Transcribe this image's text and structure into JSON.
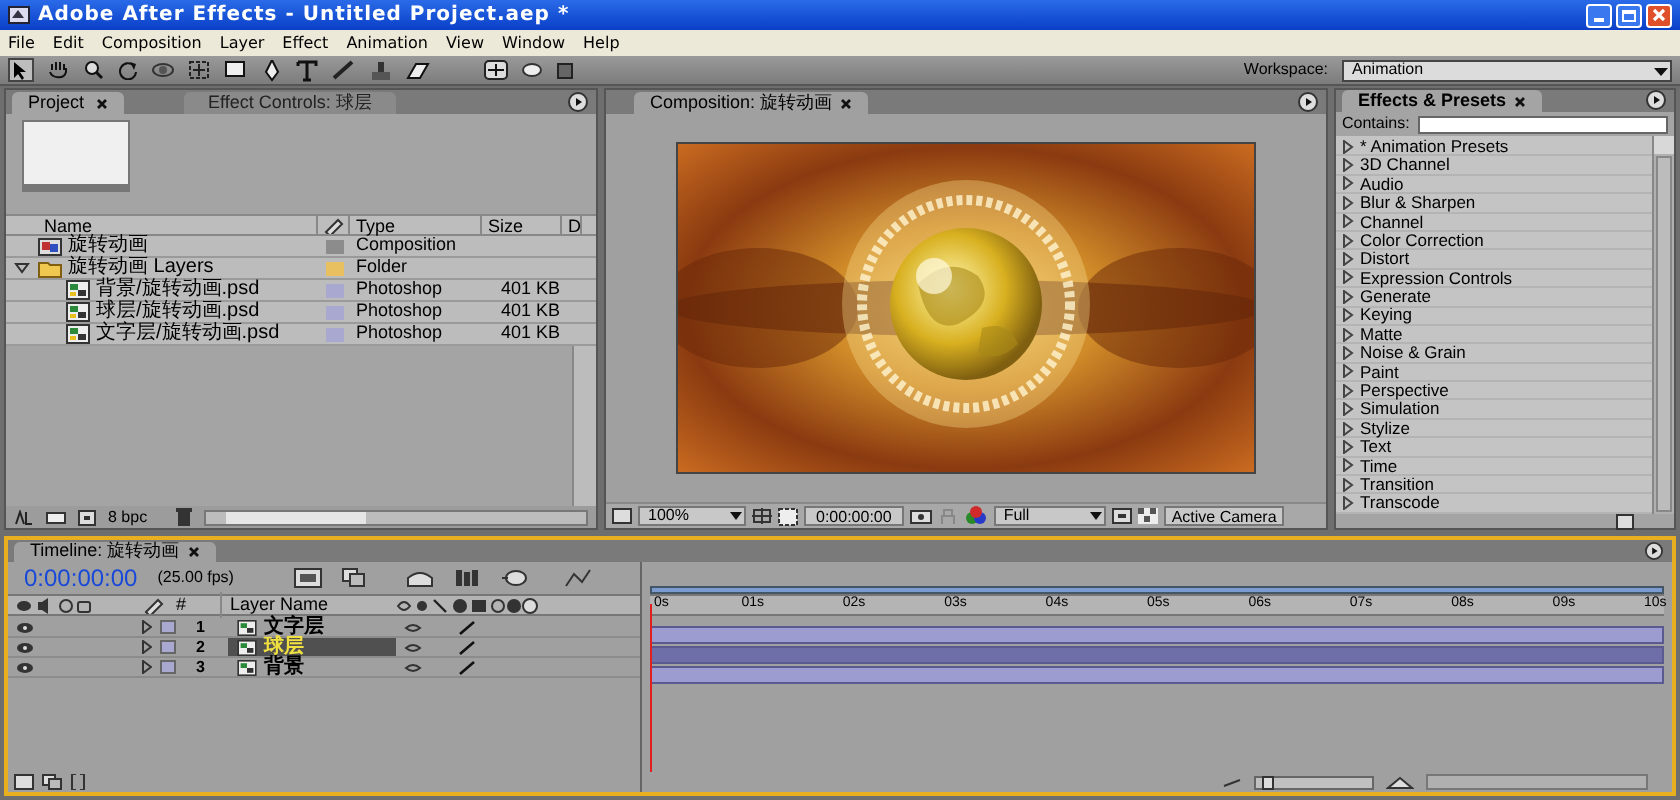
{
  "window": {
    "title": "Adobe After Effects - Untitled Project.aep *"
  },
  "menu": [
    {
      "label": "File"
    },
    {
      "label": "Edit"
    },
    {
      "label": "Composition"
    },
    {
      "label": "Layer"
    },
    {
      "label": "Effect"
    },
    {
      "label": "Animation"
    },
    {
      "label": "View"
    },
    {
      "label": "Window"
    },
    {
      "label": "Help"
    }
  ],
  "workspace": {
    "label": "Workspace:",
    "value": "Animation"
  },
  "project_panel": {
    "tabs": [
      {
        "label": "Project",
        "selected": true
      },
      {
        "label": "Effect Controls: 球层",
        "selected": false
      }
    ],
    "columns": [
      "Name",
      "Type",
      "Size",
      "D"
    ],
    "items": [
      {
        "name": "旋转动画",
        "kind": "comp",
        "color": "#8c8c8c",
        "type": "Composition"
      },
      {
        "name": "旋转动画 Layers",
        "kind": "folder",
        "color": "#e8c060",
        "type": "Folder",
        "expanded": true,
        "children": [
          {
            "name": "背景/旋转动画.psd",
            "kind": "footage",
            "color": "#a8a8d0",
            "type": "Photoshop",
            "size": "401 KB"
          },
          {
            "name": "球层/旋转动画.psd",
            "kind": "footage",
            "color": "#a8a8d0",
            "type": "Photoshop",
            "size": "401 KB"
          },
          {
            "name": "文字层/旋转动画.psd",
            "kind": "footage",
            "color": "#a8a8d0",
            "type": "Photoshop",
            "size": "401 KB"
          }
        ]
      }
    ],
    "bit_depth": "8 bpc"
  },
  "composition_panel": {
    "tab": "Composition: 旋转动画",
    "zoom": "100%",
    "timecode": "0:00:00:00",
    "resolution": "Full",
    "camera": "Active Camera"
  },
  "effects_panel": {
    "tab": "Effects & Presets",
    "contains_label": "Contains:",
    "items": [
      "* Animation Presets",
      "3D Channel",
      "Audio",
      "Blur & Sharpen",
      "Channel",
      "Color Correction",
      "Distort",
      "Expression Controls",
      "Generate",
      "Keying",
      "Matte",
      "Noise & Grain",
      "Paint",
      "Perspective",
      "Simulation",
      "Stylize",
      "Text",
      "Time",
      "Transition",
      "Transcode"
    ]
  },
  "timeline": {
    "tab": "Timeline: 旋转动画",
    "timecode": "0:00:00:00",
    "fps": "(25.00 fps)",
    "columns": [
      "#",
      "Layer Name"
    ],
    "layers": [
      {
        "number": "1",
        "name": "文字层",
        "selected": false
      },
      {
        "number": "2",
        "name": "球层",
        "selected": true
      },
      {
        "number": "3",
        "name": "背景",
        "selected": false
      }
    ],
    "zoom_slider": {
      "level": 0.05
    },
    "ticks": [
      "0s",
      "01s",
      "02s",
      "03s",
      "04s",
      "05s",
      "06s",
      "07s",
      "08s",
      "09s",
      "10s"
    ]
  }
}
